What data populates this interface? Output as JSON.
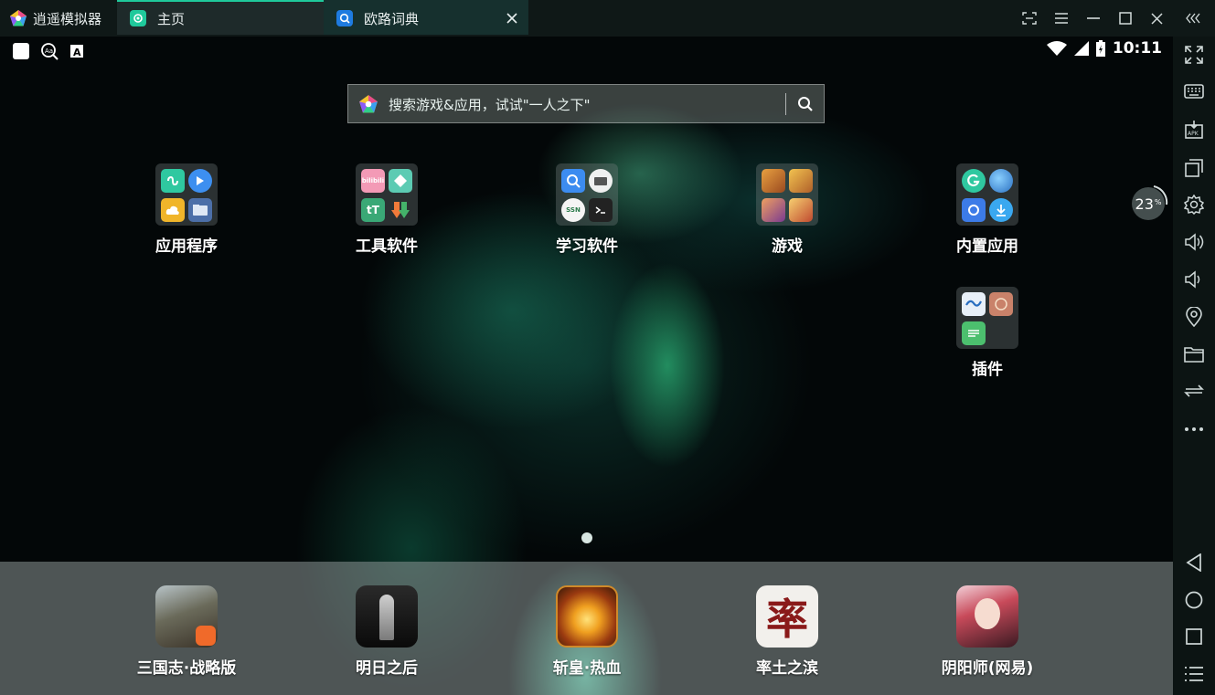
{
  "titlebar": {
    "app_name": "逍遥模拟器",
    "tabs": [
      {
        "label": "主页"
      },
      {
        "label": "欧路词典"
      }
    ]
  },
  "statusbar": {
    "time": "10:11"
  },
  "search": {
    "placeholder": "搜索游戏&应用，试试\"一人之下\""
  },
  "folders": [
    {
      "label": "应用程序"
    },
    {
      "label": "工具软件"
    },
    {
      "label": "学习软件"
    },
    {
      "label": "游戏"
    },
    {
      "label": "内置应用"
    },
    {
      "label": "插件"
    }
  ],
  "folder_icon_text": {
    "bilibili": "bilibili",
    "toutiao": "tT",
    "ssn": "SSN"
  },
  "dock": [
    {
      "label": "三国志·战略版"
    },
    {
      "label": "明日之后"
    },
    {
      "label": "斩皇·热血"
    },
    {
      "label": "率土之滨",
      "icon_char": "率"
    },
    {
      "label": "阴阳师(网易)"
    }
  ],
  "cpu": {
    "value": "23",
    "unit": "%"
  },
  "colors": {
    "accent": "#1fc99b",
    "titlebar_bg": "#0f1817",
    "sidebar_bg": "#0c1413"
  },
  "sidebar_icons": [
    "fullscreen-icon",
    "keyboard-icon",
    "apk-install-icon",
    "multi-window-icon",
    "settings-icon",
    "volume-up-icon",
    "volume-down-icon",
    "location-icon",
    "folder-icon",
    "sync-icon",
    "more-icon",
    "back-icon",
    "home-icon",
    "recent-apps-icon",
    "menu-icon"
  ]
}
